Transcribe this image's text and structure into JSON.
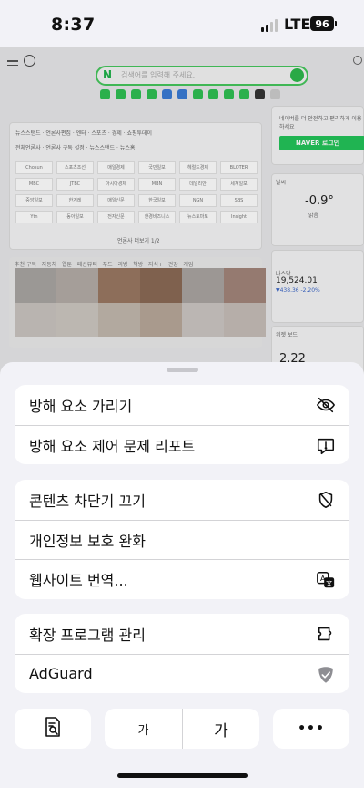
{
  "status": {
    "time": "8:37",
    "network": "LTE",
    "battery": "96"
  },
  "webpage": {
    "search_logo": "N",
    "search_placeholder": "검색어를 입력해 주세요.",
    "news_tabs": "뉴스스탠드 · 언론사편집 · 엔터 · 스포츠 · 경제 · 쇼핑투데이",
    "news_sub": "전체언론사 · 언론사 구독 설정 · 뉴스스탠드 · 뉴스홈",
    "news_logos": [
      "Chosun",
      "스포츠조선",
      "매일경제",
      "국민일보",
      "헤럴드경제",
      "BLOTER",
      "MBC",
      "JTBC",
      "아시아경제",
      "MBN",
      "데일리안",
      "세계일보",
      "중앙일보",
      "한겨레",
      "매일신문",
      "한국일보",
      "NGN",
      "SBS",
      "Ytn",
      "동아일보",
      "전자신문",
      "한경비즈니스",
      "뉴스토마토",
      "Insight"
    ],
    "pager": "언론사 더보기 1/2",
    "topic_tabs": "추천 구독 · 자동차 · 웹툰 · 패션뷰티 · 푸드 · 리빙 · 책방 · 지식+ · 건강 · 게임",
    "login_prompt": "네이버를 더 안전하고 편리하게 이용하세요",
    "naver_login": "NAVER 로그인",
    "weather_label": "날씨",
    "temperature": "-0.9°",
    "weather_state": "맑음",
    "stock_name": "나스닥",
    "stock_value": "19,524.01",
    "stock_change": "▼438.36 -2.20%",
    "trend_label": "위젯 보드",
    "trend_value": "2.22"
  },
  "sheet": {
    "group1": [
      {
        "label": "방해 요소 가리기",
        "icon": "eye-slash-icon"
      },
      {
        "label": "방해 요소 제어 문제 리포트",
        "icon": "exclamation-bubble-icon"
      }
    ],
    "group2": [
      {
        "label": "콘텐츠 차단기 끄기",
        "icon": "shield-slash-icon"
      },
      {
        "label": "개인정보 보호 완화",
        "icon": ""
      },
      {
        "label": "웹사이트 번역...",
        "icon": "translate-icon"
      }
    ],
    "group3": [
      {
        "label": "확장 프로그램 관리",
        "icon": "puzzle-icon"
      },
      {
        "label": "AdGuard",
        "icon": "adguard-shield-icon"
      }
    ],
    "bottom": {
      "reader_icon": "reader-icon",
      "font_small": "가",
      "font_large": "가",
      "more": "•••"
    }
  }
}
